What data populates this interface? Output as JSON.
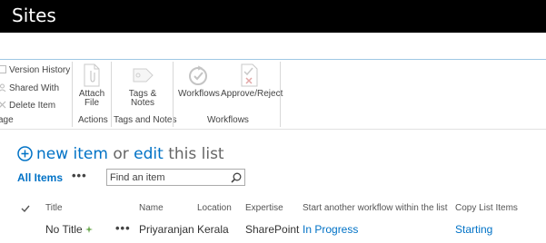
{
  "topbar": {
    "title": "Sites"
  },
  "colors": {
    "accent": "#0072c6",
    "topbar": "#000000",
    "ribbon_border": "#9fc7e4"
  },
  "ribbon": {
    "manage": {
      "version_history": "Version History",
      "shared_with": "Shared With",
      "delete_item": "Delete Item",
      "group_label": "age"
    },
    "actions": {
      "attach_file_line1": "Attach",
      "attach_file_line2": "File",
      "group_label": "Actions"
    },
    "tags": {
      "tags_notes_line1": "Tags &",
      "tags_notes_line2": "Notes",
      "group_label": "Tags and Notes"
    },
    "workflows": {
      "workflows": "Workflows",
      "approve_reject": "Approve/Reject",
      "group_label": "Workflows"
    }
  },
  "list": {
    "new_item": "new item",
    "or": "or",
    "edit": "edit",
    "this_list": "this list",
    "view_all_items": "All Items",
    "view_more": "•••",
    "search_placeholder": "Find an item"
  },
  "table": {
    "headers": {
      "title": "Title",
      "name": "Name",
      "location": "Location",
      "expertise": "Expertise",
      "workflow": "Start another workflow within the list",
      "copy": "Copy List Items"
    },
    "rows": [
      {
        "title": "No Title",
        "more": "•••",
        "name": "Priyaranjan",
        "location": "Kerala",
        "expertise": "SharePoint",
        "workflow": "In Progress",
        "copy": "Starting"
      }
    ]
  }
}
